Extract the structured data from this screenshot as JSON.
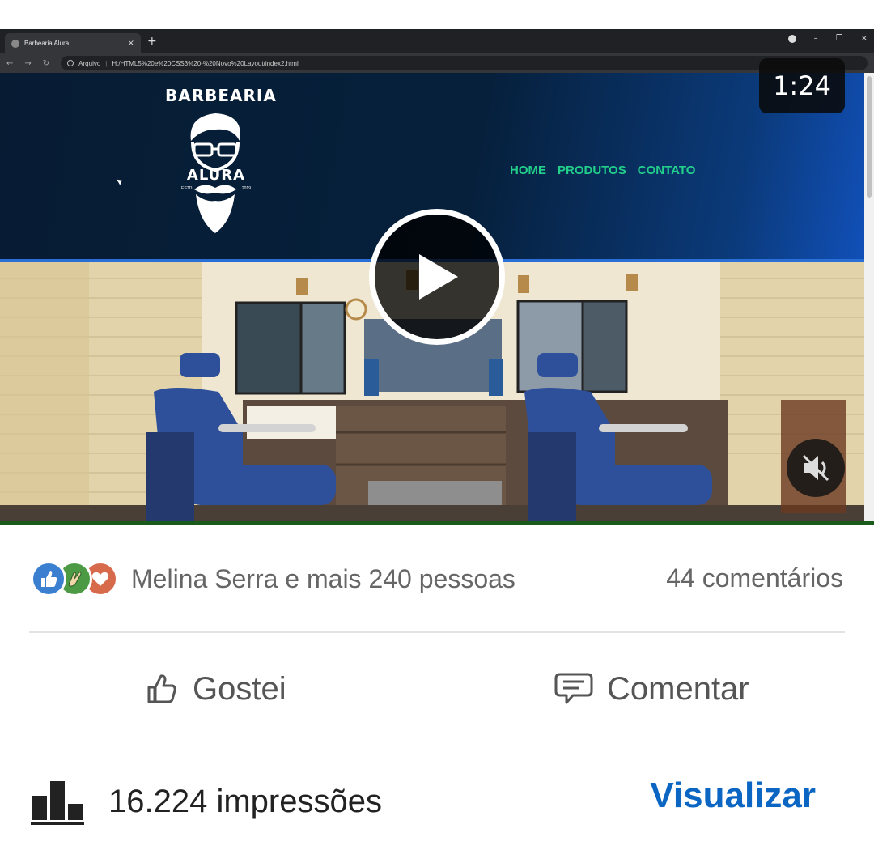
{
  "video": {
    "browser": {
      "tab_title": "Barbearia Alura",
      "tab_close": "×",
      "new_tab": "+",
      "address_prefix": "Arquivo",
      "address_separator": "|",
      "url": "H:/HTML5%20e%20CSS3%20-%20Novo%20Layout/index2.html",
      "window_controls": [
        "–",
        "❐",
        "×"
      ]
    },
    "site": {
      "brand_top": "BARBEARIA",
      "brand_bottom": "ALURA",
      "estd_left": "ESTD",
      "estd_right": "2019",
      "nav": [
        "HOME",
        "PRODUTOS",
        "CONTATO"
      ]
    },
    "time": "1:24",
    "icons": {
      "play": "play-icon",
      "mute": "muted-speaker-icon"
    },
    "colors": {
      "header_bg": "#071c33",
      "nav_text": "#22d08a",
      "header_line": "#2a6fd6"
    }
  },
  "post": {
    "reactions": {
      "icons": [
        "like-reaction-icon",
        "celebrate-reaction-icon",
        "love-reaction-icon"
      ],
      "text": "Melina Serra e mais 240 pessoas"
    },
    "comments_count": "44 comentários",
    "actions": {
      "like": "Gostei",
      "comment": "Comentar"
    },
    "stats": {
      "impressions": "16.224 impressões",
      "view_link": "Visualizar"
    },
    "colors": {
      "link": "#0a66c2",
      "secondary_text": "#666666"
    }
  }
}
